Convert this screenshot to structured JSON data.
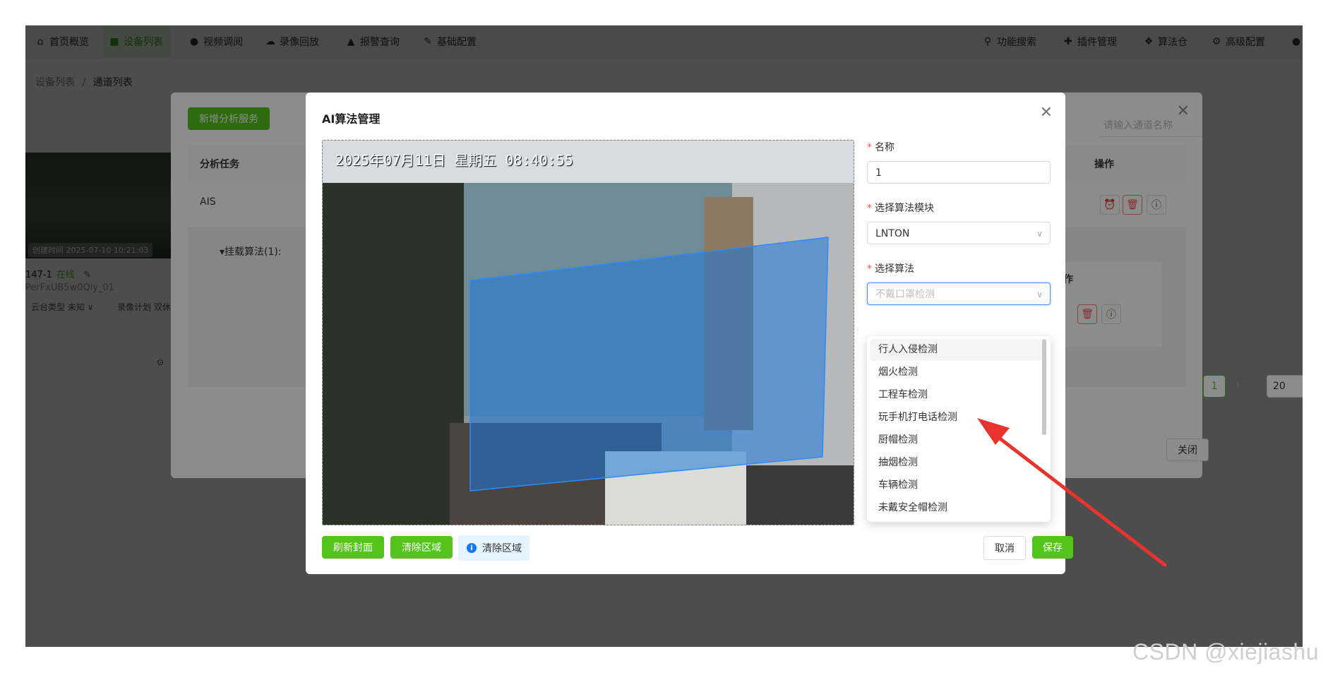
{
  "nav": {
    "items": [
      {
        "label": "首页概览",
        "icon": "home-icon",
        "glyph": "⌂"
      },
      {
        "label": "设备列表",
        "icon": "video-camera-icon",
        "glyph": "■"
      },
      {
        "label": "视频调阅",
        "icon": "play-circle-icon",
        "glyph": "●"
      },
      {
        "label": "录像回放",
        "icon": "cloud-icon",
        "glyph": "☁"
      },
      {
        "label": "报警查询",
        "icon": "alarm-icon",
        "glyph": "▲"
      },
      {
        "label": "基础配置",
        "icon": "edit-icon",
        "glyph": "✎"
      }
    ],
    "right_items": [
      {
        "label": "功能搜索",
        "icon": "search-icon",
        "glyph": "⚲"
      },
      {
        "label": "插件管理",
        "icon": "puzzle-icon",
        "glyph": "✚"
      },
      {
        "label": "算法仓",
        "icon": "dropbox-icon",
        "glyph": "❖"
      },
      {
        "label": "高级配置",
        "icon": "gear-icon",
        "glyph": "⚙"
      }
    ]
  },
  "breadcrumb": {
    "parent": "设备列表",
    "separator": "/",
    "current": "通道列表"
  },
  "camera_card": {
    "created": "创建时间 2025-07-10 10:21:03",
    "name": "147-1",
    "status": "在线",
    "id": "PerFxUB5w0Qiy_01",
    "ptz": "云台类型 未知 ∨",
    "plan": "录像计划 双休"
  },
  "analysis_dialog": {
    "add_button": "新增分析服务",
    "col_task": "分析任务",
    "col_action": "操作",
    "row_task": "AIS",
    "sub_label": "▾挂载算法(1):",
    "sub_action": "作",
    "page": "1",
    "page_size": "20",
    "search_placeholder": "请输入通道名称",
    "close_button": "关闭"
  },
  "ai_dialog": {
    "title": "AI算法管理",
    "timestamp": "2025年07月11日  星期五 08:40:55",
    "name_label": "名称",
    "name_value": "1",
    "module_label": "选择算法模块",
    "module_value": "LNTON",
    "algo_label": "选择算法",
    "algo_placeholder": "不戴口罩检测",
    "options": [
      "行人入侵检测",
      "烟火检测",
      "工程车检测",
      "玩手机打电话检测",
      "厨帽检测",
      "抽烟检测",
      "车辆检测",
      "未戴安全帽检测"
    ],
    "refresh_button": "刷新封面",
    "clear_button": "清除区域",
    "info_text": "清除区域",
    "cancel_button": "取消",
    "save_button": "保存"
  },
  "watermark": "CSDN @xiejiashu",
  "colors": {
    "accent_green": "#52c41a",
    "region_blue": "#1e78dc",
    "arrow_red": "#e8332e"
  }
}
